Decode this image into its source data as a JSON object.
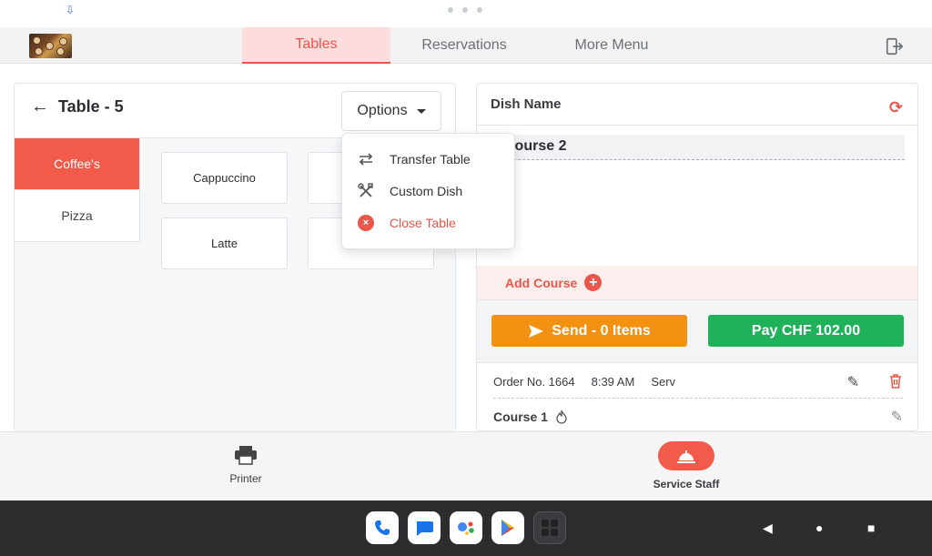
{
  "status_bar": {
    "download_icon": "download-icon"
  },
  "nav": {
    "tabs": [
      {
        "label": "Tables",
        "active": true
      },
      {
        "label": "Reservations",
        "active": false
      },
      {
        "label": "More Menu",
        "active": false
      }
    ],
    "logout_icon": "logout-icon"
  },
  "left_panel": {
    "back_label": "Table - 5",
    "options_label": "Options",
    "categories": [
      {
        "label": "Coffee's",
        "active": true
      },
      {
        "label": "Pizza",
        "active": false
      }
    ],
    "items": [
      {
        "label": "Cappuccino"
      },
      {
        "label": ""
      },
      {
        "label": "Latte"
      },
      {
        "label": ""
      }
    ]
  },
  "options_menu": {
    "items": [
      {
        "label": "Transfer Table",
        "icon": "transfer-icon"
      },
      {
        "label": "Custom Dish",
        "icon": "tools-icon"
      },
      {
        "label": "Close Table",
        "icon": "close-icon",
        "danger": true
      }
    ]
  },
  "right_panel": {
    "header": "Dish Name",
    "current_course": "Course 2",
    "add_course_label": "Add Course",
    "send_label": "Send - 0 Items",
    "pay_label": "Pay CHF 102.00",
    "order": {
      "number": "Order No. 1664",
      "time": "8:39 AM",
      "server": "Serv"
    },
    "course1_label": "Course 1"
  },
  "bottom_bar": {
    "printer_label": "Printer",
    "service_staff_label": "Service Staff"
  },
  "colors": {
    "accent": "#e8574a",
    "send": "#f39212",
    "pay": "#1fb25a"
  }
}
